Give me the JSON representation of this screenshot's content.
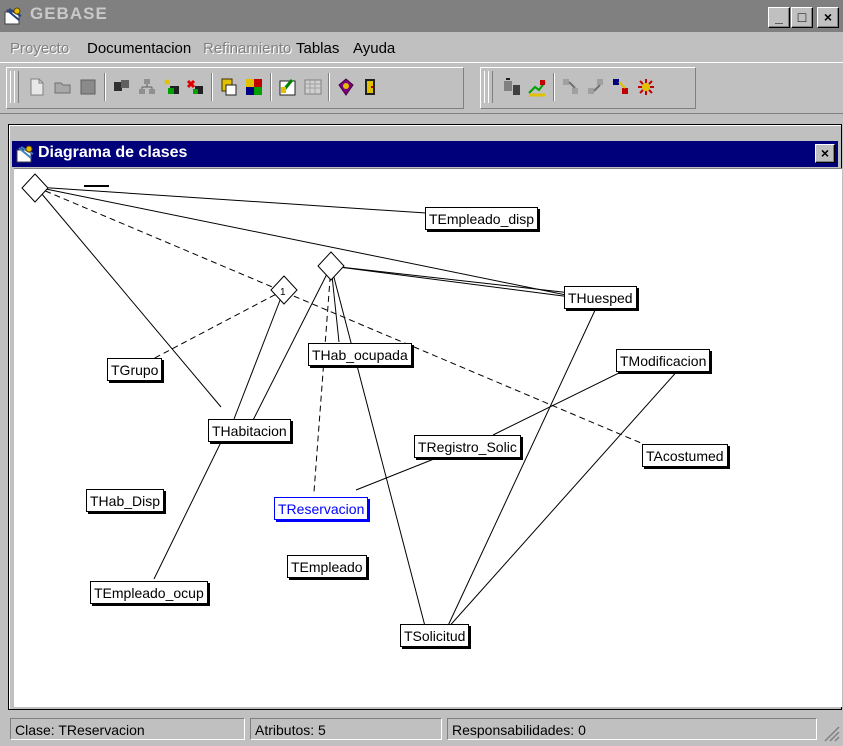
{
  "window": {
    "title": "GEBASE",
    "minimize": "_",
    "maximize": "□",
    "close": "×"
  },
  "menu": [
    {
      "label": "Proyecto",
      "enabled": false
    },
    {
      "label": "Documentacion",
      "enabled": true
    },
    {
      "label": "Refinamiento",
      "enabled": false
    },
    {
      "label": "Tablas",
      "enabled": true
    },
    {
      "label": "Ayuda",
      "enabled": true
    }
  ],
  "toolbar": {
    "icons": [
      "new-icon",
      "open-icon",
      "save-icon",
      "component-icon",
      "structure-icon",
      "add-class-icon",
      "delete-class-icon",
      "attributes-icon",
      "methods-icon",
      "edit-class-icon",
      "table-icon",
      "book-icon",
      "exit-icon",
      "tools-icon",
      "chart-icon",
      "relation-1-icon",
      "relation-2-icon",
      "relation-3-icon",
      "relation-4-icon"
    ]
  },
  "child_window": {
    "title": "Diagrama de clases",
    "close": "×"
  },
  "diagram": {
    "classes": [
      {
        "id": "c1",
        "name": "TEmpleado_disp"
      },
      {
        "id": "c2",
        "name": "THuesped"
      },
      {
        "id": "c3",
        "name": "THab_ocupada"
      },
      {
        "id": "c4",
        "name": "TModificacion"
      },
      {
        "id": "c5",
        "name": "TGrupo"
      },
      {
        "id": "c6",
        "name": "THabitacion"
      },
      {
        "id": "c7",
        "name": "TRegistro_Solic"
      },
      {
        "id": "c8",
        "name": "TAcostumed"
      },
      {
        "id": "c9",
        "name": "THab_Disp"
      },
      {
        "id": "c10",
        "name": "TReservacion",
        "selected": true
      },
      {
        "id": "c11",
        "name": "TEmpleado"
      },
      {
        "id": "c12",
        "name": "TEmpleado_ocup"
      },
      {
        "id": "c13",
        "name": "TSolicitud"
      }
    ],
    "diamonds": [
      {
        "id": "d1",
        "label": ""
      },
      {
        "id": "d2",
        "label": "1"
      },
      {
        "id": "d3",
        "label": ""
      }
    ],
    "selected_color": "#0000ff"
  },
  "status": {
    "clase": "Clase: TReservacion",
    "atributos": "Atributos: 5",
    "responsabilidades": "Responsabilidades: 0"
  },
  "colors": {
    "titlebar_inactive": "#808080",
    "child_titlebar": "#00007b",
    "face": "#c0c0c0"
  }
}
